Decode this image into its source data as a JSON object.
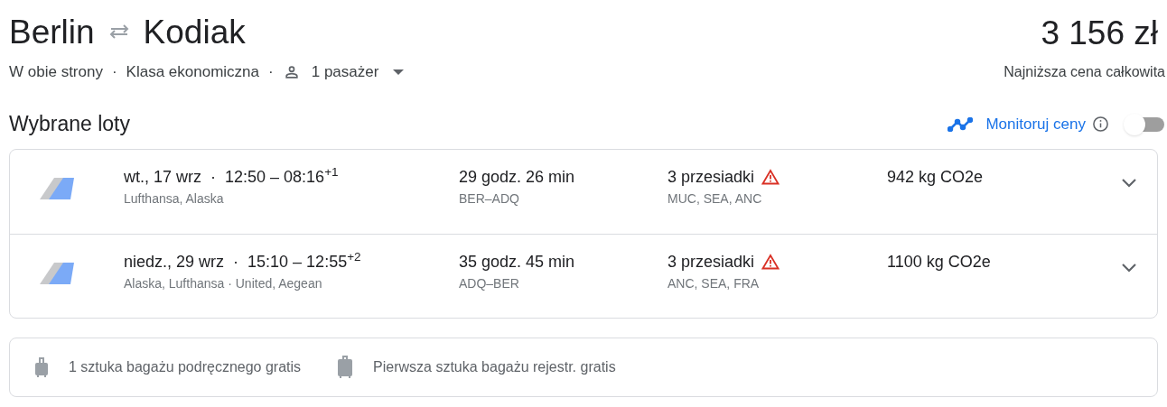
{
  "route": {
    "origin": "Berlin",
    "destination": "Kodiak"
  },
  "price": {
    "amount": "3 156 zł",
    "caption": "Najniższa cena całkowita"
  },
  "options": [
    {
      "kind": "text",
      "text": "W obie strony"
    },
    {
      "kind": "separator",
      "text": "·"
    },
    {
      "kind": "text",
      "text": "Klasa ekonomiczna"
    },
    {
      "kind": "separator",
      "text": "·"
    },
    {
      "kind": "passengers",
      "text": "1 pasażer"
    }
  ],
  "section": {
    "title": "Wybrane loty",
    "track_label": "Monitoruj ceny",
    "track_on": false
  },
  "flights": [
    {
      "date_times": "wt., 17 wrz  ·  12:50 – 08:16$^{+1}$",
      "airlines": "Lufthansa, Alaska",
      "duration": "29 godz. 26 min",
      "route": "BER–ADQ",
      "stops": "3 przesiadki",
      "warning": true,
      "stop_airports": "MUC, SEA, ANC",
      "emissions": "942 kg CO2e"
    },
    {
      "date_times": "niedz., 29 wrz  ·  15:10 – 12:55$^{+2}$",
      "airlines": "Alaska, Lufthansa · United, Aegean",
      "duration": "35 godz. 45 min",
      "route": "ADQ–BER",
      "stops": "3 przesiadki",
      "warning": true,
      "stop_airports": "ANC, SEA, FRA",
      "emissions": "1100 kg CO2e"
    }
  ],
  "baggage": [
    {
      "kind": "carry_on",
      "text": "1 sztuka bagażu podręcznego gratis"
    },
    {
      "kind": "checked",
      "text": "Pierwsza sztuka bagażu rejestr. gratis"
    }
  ]
}
